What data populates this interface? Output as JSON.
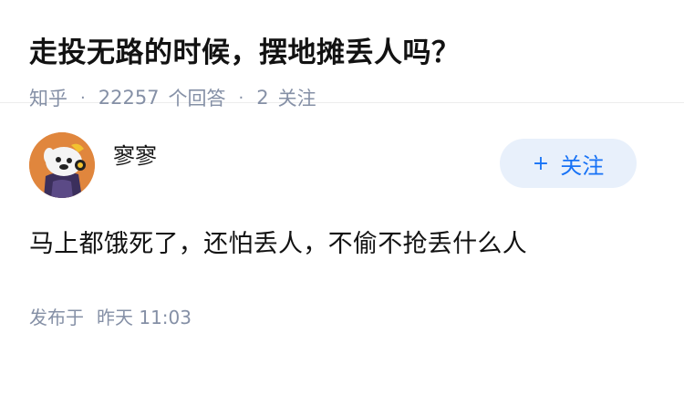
{
  "question": {
    "title": "走投无路的时候，摆地摊丢人吗？",
    "source": "知乎",
    "separator": "·",
    "answers_count": "22257",
    "answers_label": "个回答",
    "followers_count": "2",
    "followers_label": "关注"
  },
  "answer": {
    "author": {
      "name": "寥寥",
      "avatar_icon": "cartoon-animal-avatar-icon"
    },
    "follow_button": {
      "plus": "+",
      "label": "关注"
    },
    "content": "马上都饿死了，还怕丢人，不偷不抢丢什么人",
    "time_prefix": "发布于",
    "time_value": "昨天 11:03"
  },
  "colors": {
    "meta": "#8590a6",
    "accent": "#1772f6",
    "button_bg": "#e8f0fb",
    "avatar_bg": "#e0863d"
  }
}
